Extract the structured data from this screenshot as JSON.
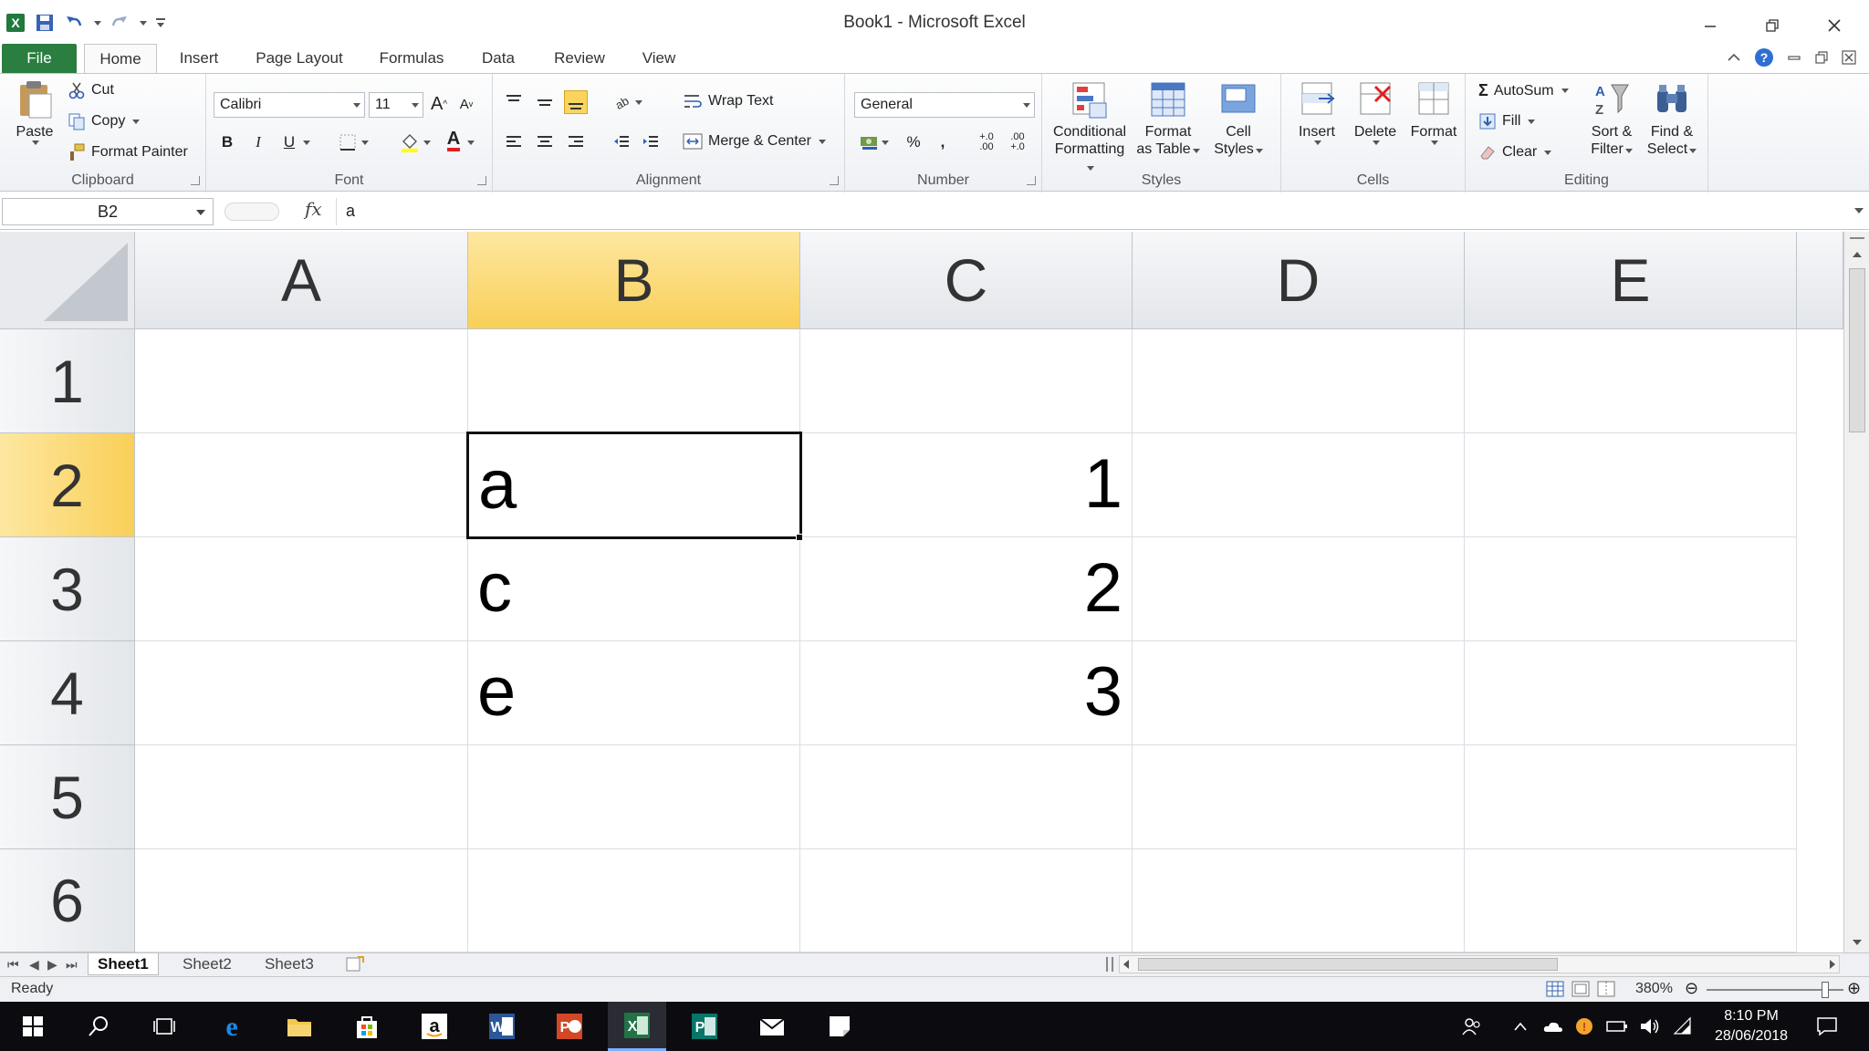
{
  "window": {
    "title": "Book1  -  Microsoft Excel",
    "app_icon": "excel-icon"
  },
  "tabs": [
    "File",
    "Home",
    "Insert",
    "Page Layout",
    "Formulas",
    "Data",
    "Review",
    "View"
  ],
  "active_tab": "Home",
  "ribbon": {
    "clipboard": {
      "label": "Clipboard",
      "paste": "Paste",
      "cut": "Cut",
      "copy": "Copy",
      "format_painter": "Format Painter"
    },
    "font": {
      "label": "Font",
      "font_name": "Calibri",
      "font_size": "11",
      "bold": "B",
      "italic": "I",
      "underline": "U",
      "grow": "A",
      "shrink": "A",
      "font_color": "A"
    },
    "alignment": {
      "label": "Alignment",
      "wrap_text": "Wrap Text",
      "merge_center": "Merge & Center"
    },
    "number": {
      "label": "Number",
      "format": "General",
      "percent": "%",
      "comma": ",",
      "inc_decimal": "+.0 .00",
      "dec_decimal": ".00 +.0"
    },
    "styles": {
      "label": "Styles",
      "conditional_1": "Conditional",
      "conditional_2": "Formatting",
      "format_table_1": "Format",
      "format_table_2": "as Table",
      "cell_styles_1": "Cell",
      "cell_styles_2": "Styles"
    },
    "cells": {
      "label": "Cells",
      "insert": "Insert",
      "delete": "Delete",
      "format": "Format"
    },
    "editing": {
      "label": "Editing",
      "autosum": "AutoSum",
      "fill": "Fill",
      "clear": "Clear",
      "sort_1": "Sort &",
      "sort_2": "Filter",
      "find_1": "Find &",
      "find_2": "Select"
    }
  },
  "formula_bar": {
    "name_box": "B2",
    "fx": "fx",
    "value": "a"
  },
  "grid": {
    "columns": [
      "A",
      "B",
      "C",
      "D",
      "E"
    ],
    "selected_column": "B",
    "rows": [
      "1",
      "2",
      "3",
      "4",
      "5",
      "6"
    ],
    "selected_row": "2",
    "active_cell": "B2",
    "cells": {
      "B2": "a",
      "C2": "1",
      "B3": "c",
      "C3": "2",
      "B4": "e",
      "C4": "3"
    }
  },
  "sheets": [
    "Sheet1",
    "Sheet2",
    "Sheet3"
  ],
  "active_sheet": "Sheet1",
  "status": {
    "mode": "Ready",
    "zoom": "380%"
  },
  "taskbar": {
    "time": "8:10 PM",
    "date": "28/06/2018"
  },
  "colors": {
    "excel_green": "#2a7e3f",
    "selection_header": "#f9cf57",
    "taskbar": "#0c0c10"
  }
}
